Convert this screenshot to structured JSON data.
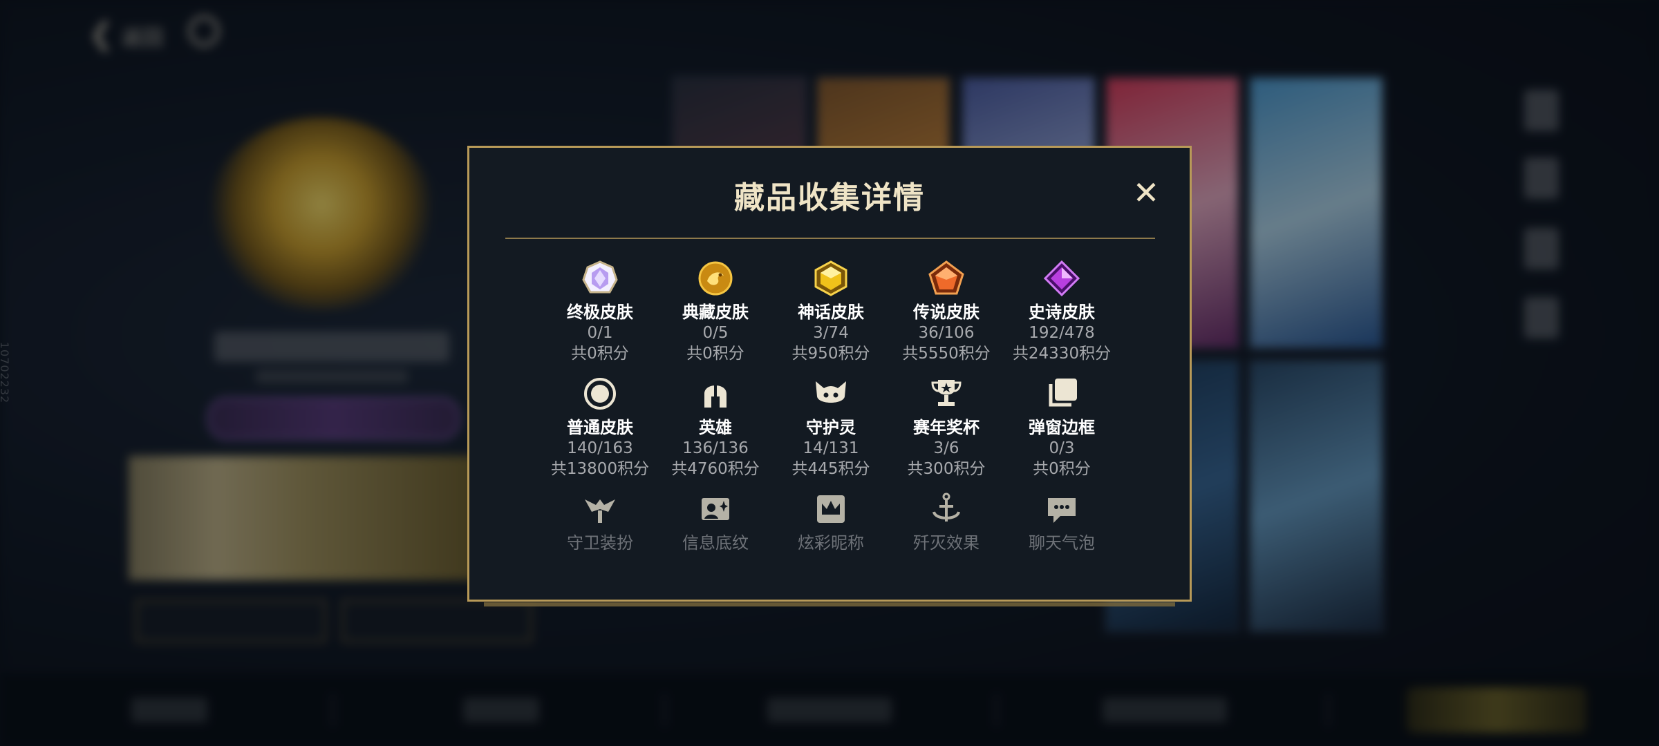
{
  "background": {
    "back_label": "返回",
    "side_id": "10702232"
  },
  "modal": {
    "title": "藏品收集详情",
    "close_icon": "close-icon",
    "items": [
      {
        "label": "终极皮肤",
        "count": "0/1",
        "points": "共0积分",
        "icon": "ultimate-skin-gem-icon",
        "color": "#b79cf0"
      },
      {
        "label": "典藏皮肤",
        "count": "0/5",
        "points": "共0积分",
        "icon": "dragon-coin-icon",
        "color": "#e3a91c"
      },
      {
        "label": "神话皮肤",
        "count": "3/74",
        "points": "共950积分",
        "icon": "mythic-gem-icon",
        "color": "#f0c21a"
      },
      {
        "label": "传说皮肤",
        "count": "36/106",
        "points": "共5550积分",
        "icon": "legend-gem-icon",
        "color": "#ef6a2a"
      },
      {
        "label": "史诗皮肤",
        "count": "192/478",
        "points": "共24330积分",
        "icon": "epic-gem-icon",
        "color": "#b93fe0"
      },
      {
        "label": "普通皮肤",
        "count": "140/163",
        "points": "共13800积分",
        "icon": "normal-skin-ring-icon",
        "color": "#e8e1cf"
      },
      {
        "label": "英雄",
        "count": "136/136",
        "points": "共4760积分",
        "icon": "helmet-icon",
        "color": "#e8e1cf"
      },
      {
        "label": "守护灵",
        "count": "14/131",
        "points": "共445积分",
        "icon": "guardian-spirit-icon",
        "color": "#e8e1cf"
      },
      {
        "label": "赛年奖杯",
        "count": "3/6",
        "points": "共300积分",
        "icon": "trophy-icon",
        "color": "#e8e1cf"
      },
      {
        "label": "弹窗边框",
        "count": "0/3",
        "points": "共0积分",
        "icon": "frame-icon",
        "color": "#e8e1cf"
      },
      {
        "label": "守卫装扮",
        "icon": "ward-skin-icon",
        "color": "#e8e1cf"
      },
      {
        "label": "信息底纹",
        "icon": "profile-banner-icon",
        "color": "#e8e1cf"
      },
      {
        "label": "炫彩昵称",
        "icon": "crown-nickname-icon",
        "color": "#e8e1cf"
      },
      {
        "label": "歼灭效果",
        "icon": "anchor-icon",
        "color": "#e8e1cf"
      },
      {
        "label": "聊天气泡",
        "icon": "chat-bubble-icon",
        "color": "#e8e1cf"
      }
    ]
  }
}
